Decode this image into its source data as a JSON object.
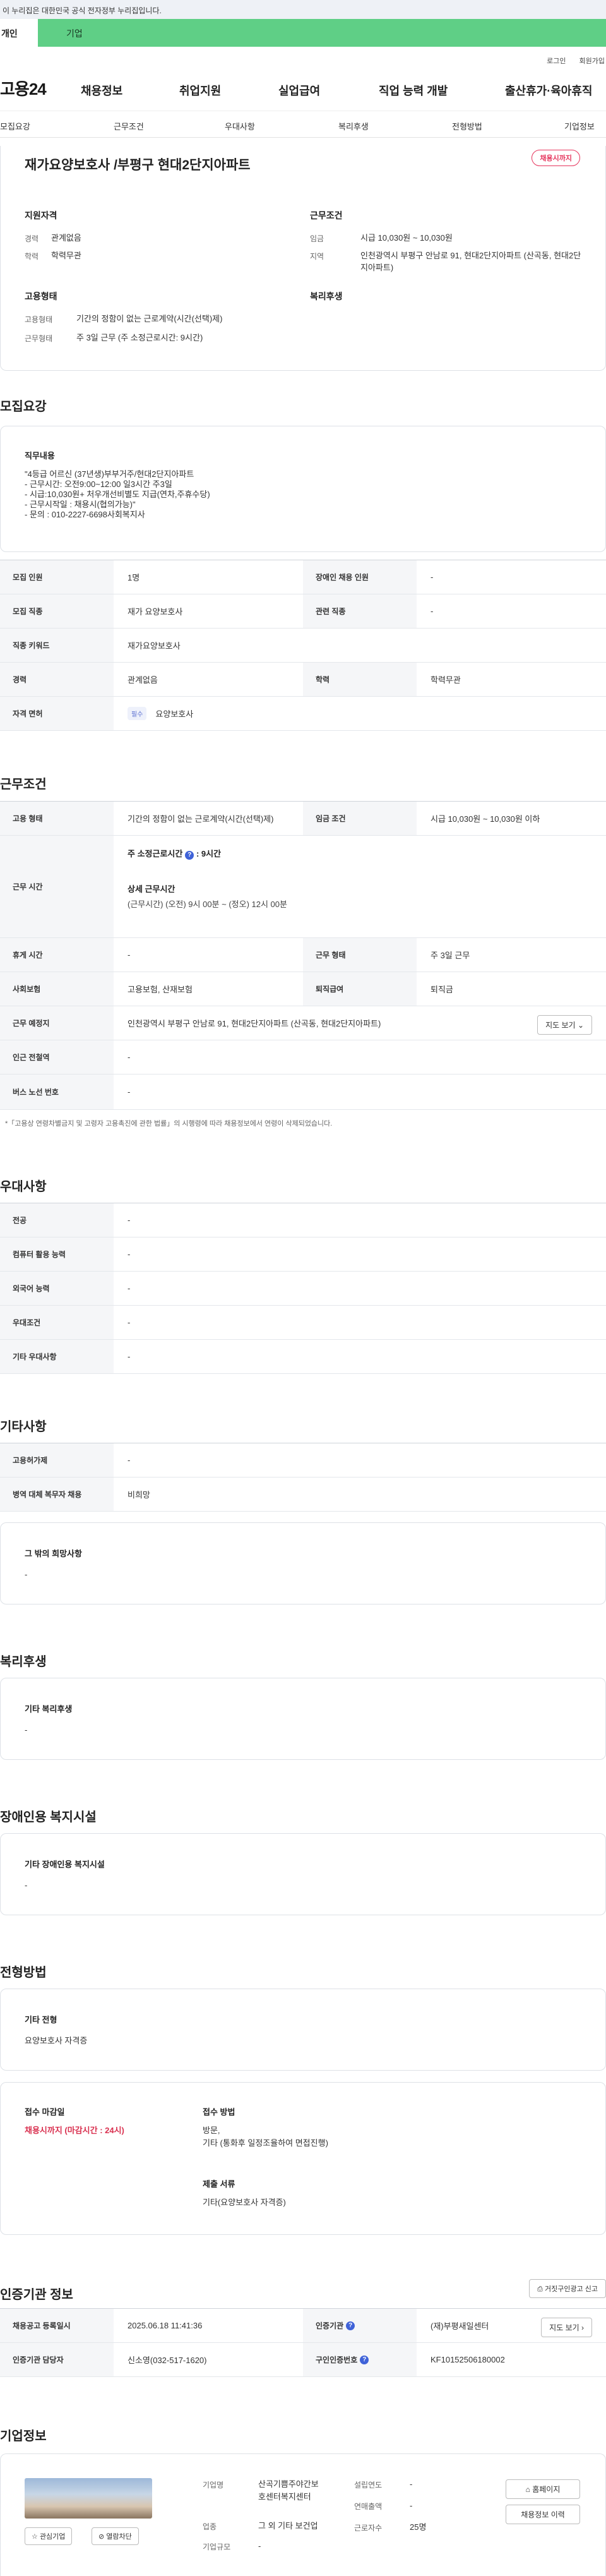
{
  "gov_banner": "이 누리집은 대한민국 공식 전자정부 누리집입니다.",
  "top_tabs": [
    "개인",
    "기업"
  ],
  "util": {
    "login": "로그인",
    "join": "회원가입"
  },
  "logo": "고용24",
  "gnb": [
    "채용정보",
    "취업지원",
    "실업급여",
    "직업 능력 개발",
    "출산휴가·육아휴직"
  ],
  "subnav": [
    "모집요강",
    "근무조건",
    "우대사항",
    "복리후생",
    "전형방법",
    "기업정보"
  ],
  "summary": {
    "title": "재가요양보호사 /부평구 현대2단지아파트",
    "badge": "채용시까지",
    "qual_head": "지원자격",
    "career_k": "경력",
    "career_v": "관계없음",
    "edu_k": "학력",
    "edu_v": "학력무관",
    "cond_head": "근무조건",
    "wage_k": "임금",
    "wage_v": "시급 10,030원 ~ 10,030원",
    "area_k": "지역",
    "area_v": "인천광역시 부평구 안남로 91, 현대2단지아파트 (산곡동, 현대2단지아파트)",
    "emp_head": "고용형태",
    "emptype_k": "고용형태",
    "emptype_v": "기간의 정함이 없는 근로계약(시간(선택)제)",
    "worktype_k": "근무형태",
    "worktype_v": "주 3일 근무 (주 소정근로시간: 9시간)",
    "welfare_head": "복리후생"
  },
  "recruit": {
    "heading": "모집요강",
    "duty_head": "직무내용",
    "duty_lines": [
      "\"4등급 어르신 (37년생)부부거주/현대2단지아파트",
      "- 근무시간: 오전9:00~12:00 일3시간 주3일",
      "- 시급:10,030원+ 처우개선비별도 지급(연차,주휴수당)",
      "- 근무시작일 : 채용시(협의가능)\"",
      "- 문의 : 010-2227-6698사회복지사"
    ],
    "rows": [
      {
        "k1": "모집 인원",
        "v1": "1명",
        "k2": "장애인 채용 인원",
        "v2": "-"
      },
      {
        "k1": "모집 직종",
        "v1": "재가 요양보호사",
        "k2": "관련 직종",
        "v2": "-"
      },
      {
        "k1": "직종 키워드",
        "v1": "재가요양보호사"
      },
      {
        "k1": "경력",
        "v1": "관계없음",
        "k2": "학력",
        "v2": "학력무관"
      },
      {
        "k1": "자격 면허",
        "chip": "필수",
        "v1": "요양보호사"
      }
    ]
  },
  "work": {
    "heading": "근무조건",
    "r1": {
      "k1": "고용 형태",
      "v1": "기간의 정함이 없는 근로계약(시간(선택)제)",
      "k2": "임금 조건",
      "v2": "시급 10,030원 ~ 10,030원 이하"
    },
    "time": {
      "k": "근무 시간",
      "weekly": "주 소정근로시간",
      "weekly_v": ": 9시간",
      "detail_h": "상세 근무시간",
      "detail_v": "(근무시간) (오전) 9시 00분 ~ (정오) 12시 00분"
    },
    "r3": {
      "k1": "휴게 시간",
      "v1": "-",
      "k2": "근무 형태",
      "v2": "주 3일 근무"
    },
    "r4": {
      "k1": "사회보험",
      "v1": "고용보험, 산재보험",
      "k2": "퇴직급여",
      "v2": "퇴직금"
    },
    "r5": {
      "k1": "근무 예정지",
      "v1": "인천광역시 부평구 안남로 91, 현대2단지아파트 (산곡동, 현대2단지아파트)",
      "btn": "지도 보기"
    },
    "r6": {
      "k1": "인근 전철역",
      "v1": "-"
    },
    "r7": {
      "k1": "버스 노선 번호",
      "v1": "-"
    },
    "note": "*「고용상 연령차별금지 및 고령자 고용촉진에 관한 법률」의 시행령에 따라 채용정보에서 연령이 삭제되었습니다."
  },
  "pref": {
    "heading": "우대사항",
    "rows": [
      {
        "k": "전공",
        "v": "-"
      },
      {
        "k": "컴퓨터 활용 능력",
        "v": "-"
      },
      {
        "k": "외국어 능력",
        "v": "-"
      },
      {
        "k": "우대조건",
        "v": "-"
      },
      {
        "k": "기타 우대사항",
        "v": "-"
      }
    ]
  },
  "etc": {
    "heading": "기타사항",
    "rows": [
      {
        "k": "고용허가제",
        "v": "-"
      },
      {
        "k": "병역 대체 복무자 채용",
        "v": "비희망"
      }
    ],
    "other_h": "그 밖의 희망사항",
    "other_v": "-"
  },
  "welfare": {
    "heading": "복리후생",
    "h": "기타 복리후생",
    "v": "-"
  },
  "disab": {
    "heading": "장애인용 복지시설",
    "h": "기타 장애인용 복지시설",
    "v": "-"
  },
  "select": {
    "heading": "전형방법",
    "h": "기타 전형",
    "v": "요양보호사 자격증",
    "deadline_h": "접수 마감일",
    "deadline_v": "채용시까지 (마감시간 : 24시)",
    "method_h": "접수 방법",
    "method_v1": "방문,",
    "method_v2": "기타 (통화후 일정조율하여 면접진행)",
    "docs_h": "제출 서류",
    "docs_v": "기타(요양보호사 자격증)"
  },
  "agency": {
    "heading": "인증기관 정보",
    "report_btn": "거짓구인광고 신고",
    "r1": {
      "k1": "채용공고 등록일시",
      "v1": "2025.06.18 11:41:36",
      "k2": "인증기관",
      "v2": "(재)부평새일센터",
      "btn": "지도 보기"
    },
    "r2": {
      "k1": "인증기관 담당자",
      "v1": "신소영(032-517-1620)",
      "k2": "구인인증번호",
      "v2": "KF10152506180002"
    }
  },
  "company": {
    "heading": "기업정보",
    "fav_btn": "관심기업",
    "block_btn": "열람차단",
    "name_k": "기업명",
    "name_v1": "산곡기쁨주야간보",
    "name_v2": "호센터복지센터",
    "industry_k": "업종",
    "industry_v": "그 외 기타 보건업",
    "size_k": "기업규모",
    "size_v": "-",
    "found_k": "설립연도",
    "found_v": "-",
    "sales_k": "연매출액",
    "sales_v": "-",
    "emp_k": "근로자수",
    "emp_v": "25명",
    "home_btn": "홈페이지",
    "list_btn": "채용정보 이력"
  }
}
